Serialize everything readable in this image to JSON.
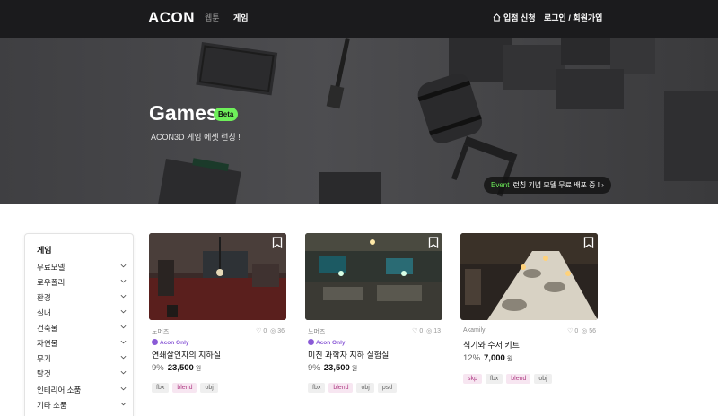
{
  "nav": {
    "logo": "ACON",
    "tabs": [
      {
        "label": "웹툰",
        "active": false
      },
      {
        "label": "게임",
        "active": true
      }
    ],
    "store_apply": "입점 신청",
    "login": "로그인 / 회원가입"
  },
  "hero": {
    "title": "Games",
    "badge": "Beta",
    "subtitle": "ACON3D 게임 에셋 런칭 !",
    "event_tag": "Event",
    "event_text": "런칭 기념 모델 무료 배포 중 ! ›"
  },
  "sidebar": {
    "title": "게임",
    "items": [
      "무료모델",
      "로우폴리",
      "환경",
      "실내",
      "건축물",
      "자연물",
      "무기",
      "탈것",
      "인테리어 소품",
      "기타 소품"
    ]
  },
  "products": [
    {
      "author": "노머즈",
      "likes": "0",
      "views": "36",
      "badge": "Acon Only",
      "name": "연쇄살인자의 지하실",
      "discount": "9%",
      "price": "23,500",
      "currency": "원",
      "tags": [
        "fbx",
        "blend",
        "obj"
      ]
    },
    {
      "author": "노머즈",
      "likes": "0",
      "views": "13",
      "badge": "Acon Only",
      "name": "미친 과학자 지하 실험실",
      "discount": "9%",
      "price": "23,500",
      "currency": "원",
      "tags": [
        "fbx",
        "blend",
        "obj",
        "psd"
      ]
    },
    {
      "author": "Akamily",
      "likes": "0",
      "views": "56",
      "badge": "",
      "name": "식기와 수저 키트",
      "discount": "12%",
      "price": "7,000",
      "currency": "원",
      "tags": [
        "skp",
        "fbx",
        "blend",
        "obj"
      ]
    }
  ],
  "colors": {
    "nav_bg": "#1b1b1d",
    "accent_green": "#6ef05a",
    "acon_only": "#8a5ad6",
    "tag_pink_text": "#b03e86"
  }
}
